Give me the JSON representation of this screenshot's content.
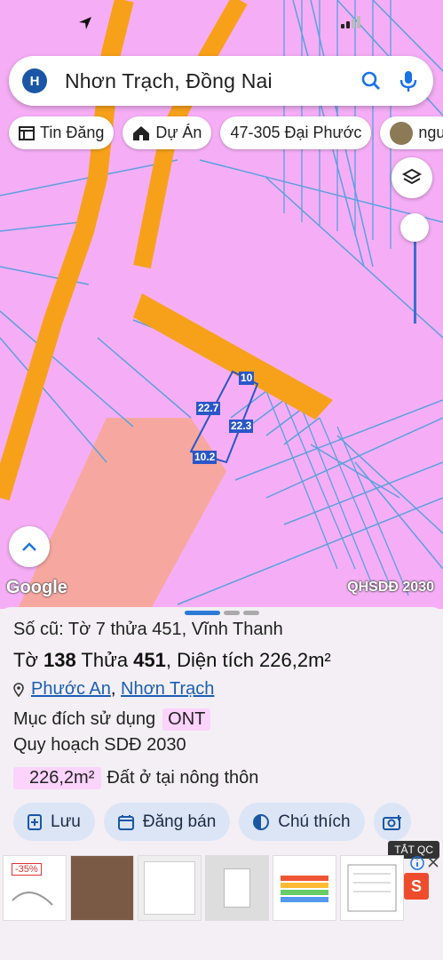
{
  "search": {
    "avatar_letter": "H",
    "query": "Nhơn Trạch, Đồng Nai"
  },
  "chips": [
    {
      "label": "Tin Đăng"
    },
    {
      "label": "Dự Án"
    },
    {
      "label": "47-305 Đại Phước"
    },
    {
      "label": "ngu"
    }
  ],
  "map": {
    "dimensions": [
      "10",
      "22.7",
      "22.3",
      "10.2"
    ],
    "attribution": "Google",
    "layer_label": "QHSDĐ 2030",
    "colors": {
      "residential": "#f5aef5",
      "road": "#f7a11a",
      "parcel_lines": "#5aa0e0",
      "other_land": "#f6a8a0"
    }
  },
  "details": {
    "old_record": "Số cũ: Tờ 7 thửa 451, Vĩnh Thanh",
    "sheet_prefix": "Tờ ",
    "sheet_no": "138",
    "plot_prefix": " Thửa ",
    "plot_no": "451",
    "area_text": ", Diện tích 226,2m²",
    "ward": "Phước An",
    "district": "Nhơn Trạch",
    "separator": ",",
    "purpose_label": "Mục đích sử dụng",
    "purpose_code": "ONT",
    "planning": "Quy hoạch SDĐ 2030",
    "planned_area": "226,2m²",
    "planned_use": "Đất ở tại nông thôn"
  },
  "actions": [
    {
      "label": "Lưu"
    },
    {
      "label": "Đăng bán"
    },
    {
      "label": "Chú thích"
    }
  ],
  "ad": {
    "close_label": "TẮT QC",
    "promo": "-35%"
  }
}
